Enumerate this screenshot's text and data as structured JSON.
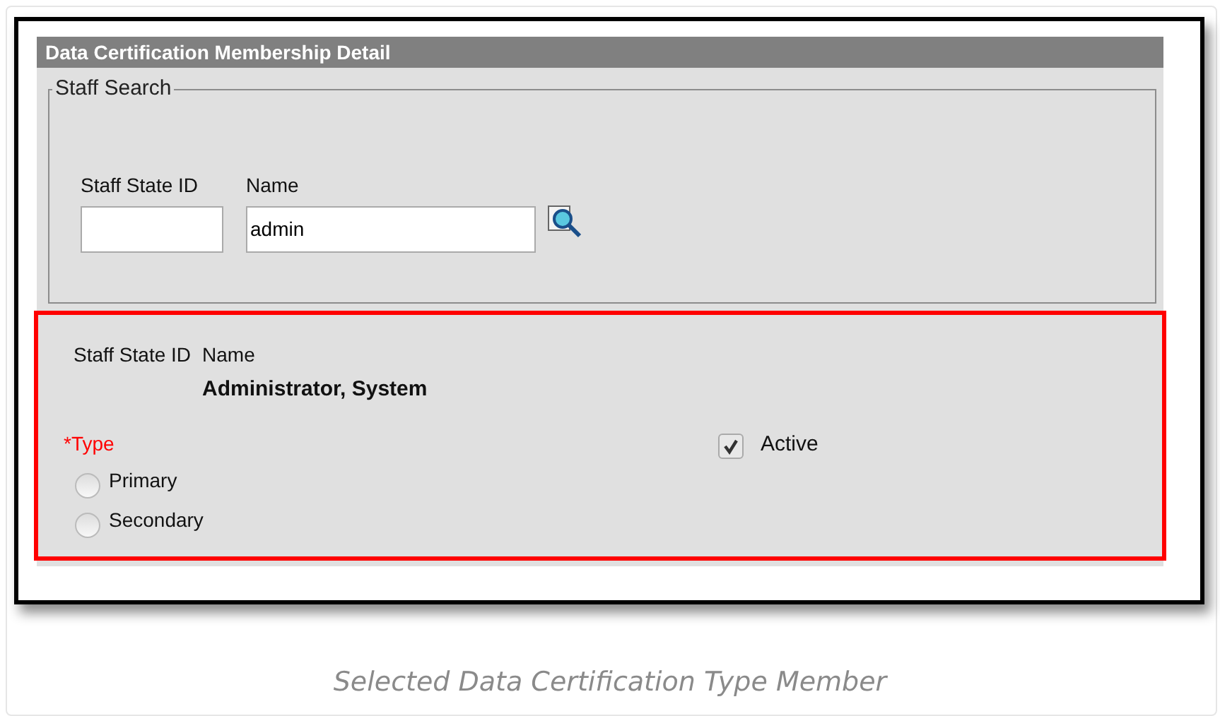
{
  "panel": {
    "title": "Data Certification Membership Detail"
  },
  "staff_search": {
    "legend": "Staff Search",
    "fields": [
      {
        "label": "Staff State ID"
      },
      {
        "label": "Name",
        "value": "admin"
      }
    ]
  },
  "selected": {
    "id_label": "Staff State ID",
    "name_label": "Name",
    "name": "Administrator, System",
    "type_label": "*Type",
    "type_options": [
      {
        "label": "Primary",
        "selected": false
      },
      {
        "label": "Secondary",
        "selected": false
      }
    ],
    "active": {
      "label": "Active",
      "checked": true
    }
  },
  "caption": "Selected Data Certification Type Member"
}
